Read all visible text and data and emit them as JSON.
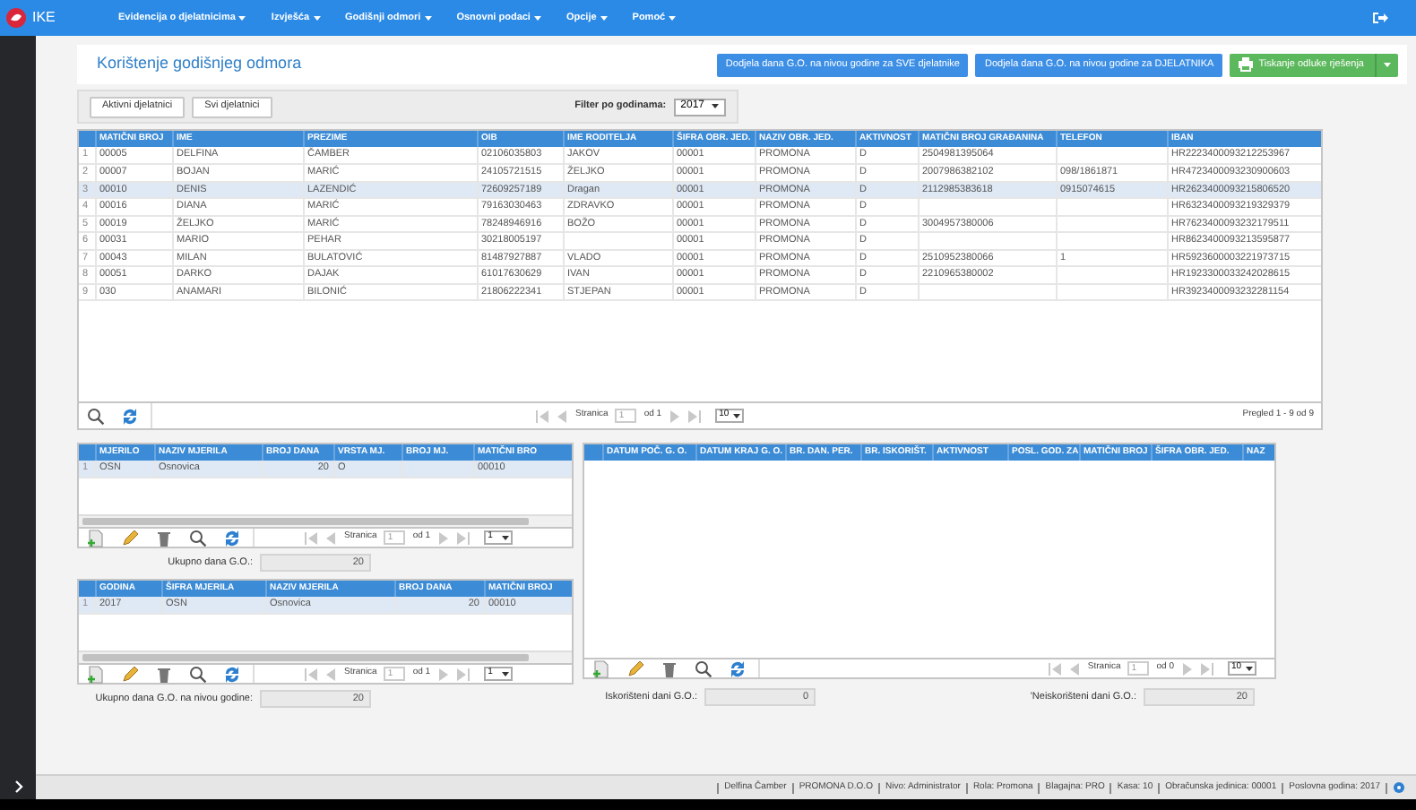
{
  "nav": {
    "brand": "IKE",
    "menus": [
      "Evidencija o djelatnicima",
      "Izvješća",
      "Godišnji odmori",
      "Osnovni podaci",
      "Opcije",
      "Pomoć"
    ]
  },
  "header": {
    "title": "Korištenje godišnjeg odmora",
    "buttons": [
      {
        "label": "Dodjela dana G.O. na nivou godine za SVE djelatnike",
        "kind": "primary"
      },
      {
        "label": "Dodjela dana G.O. na nivou godine za DJELATNIKA",
        "kind": "primary"
      },
      {
        "label": "Tiskanje odluke rješenja",
        "kind": "print"
      }
    ]
  },
  "filter": {
    "buttons": [
      "Aktivni djelatnici",
      "Svi djelatnici"
    ],
    "label": "Filter po godinama:",
    "year": "2017"
  },
  "employees": {
    "columns": [
      "MATIČNI BROJ",
      "IME",
      "PREZIME",
      "OIB",
      "IME RODITELJA",
      "ŠIFRA OBR. JED.",
      "NAZIV OBR. JED.",
      "AKTIVNOST",
      "MATIČNI BROJ GRAĐANINA",
      "TELEFON",
      "IBAN"
    ],
    "rows": [
      {
        "num": "1",
        "selected": false,
        "cells": [
          "00005",
          "DELFINA",
          "ČAMBER",
          "02106035803",
          "JAKOV",
          "00001",
          "PROMONA",
          "D",
          "2504981395064",
          "",
          "HR2223400093212253967"
        ]
      },
      {
        "num": "2",
        "selected": false,
        "cells": [
          "00007",
          "BOJAN",
          "MARIĆ",
          "24105721515",
          "ŽELJKO",
          "00001",
          "PROMONA",
          "D",
          "2007986382102",
          "098/1861871",
          "HR4723400093230900603"
        ]
      },
      {
        "num": "3",
        "selected": true,
        "cells": [
          "00010",
          "DENIS",
          "LAZENDIĆ",
          "72609257189",
          "Dragan",
          "00001",
          "PROMONA",
          "D",
          "2112985383618",
          "0915074615",
          "HR2623400093215806520"
        ]
      },
      {
        "num": "4",
        "selected": false,
        "cells": [
          "00016",
          "DIANA",
          "MARIĆ",
          "79163030463",
          "ZDRAVKO",
          "00001",
          "PROMONA",
          "D",
          "",
          "",
          "HR6323400093219329379"
        ]
      },
      {
        "num": "5",
        "selected": false,
        "cells": [
          "00019",
          "ŽELJKO",
          "MARIĆ",
          "78248946916",
          "BOŽO",
          "00001",
          "PROMONA",
          "D",
          "3004957380006",
          "",
          "HR7623400093232179511"
        ]
      },
      {
        "num": "6",
        "selected": false,
        "cells": [
          "00031",
          "MARIO",
          "PEHAR",
          "30218005197",
          "",
          "00001",
          "PROMONA",
          "D",
          "",
          "",
          "HR8623400093213595877"
        ]
      },
      {
        "num": "7",
        "selected": false,
        "cells": [
          "00043",
          "MILAN",
          "BULATOVIĆ",
          "81487927887",
          "VLADO",
          "00001",
          "PROMONA",
          "D",
          "2510952380066",
          "1",
          "HR5923600003221973715"
        ]
      },
      {
        "num": "8",
        "selected": false,
        "cells": [
          "00051",
          "DARKO",
          "DAJAK",
          "61017630629",
          "IVAN",
          "00001",
          "PROMONA",
          "D",
          "2210965380002",
          "",
          "HR1923300033242028615"
        ]
      },
      {
        "num": "9",
        "selected": false,
        "cells": [
          "030",
          "ANAMARI",
          "BILONIĆ",
          "21806222341",
          "STJEPAN",
          "00001",
          "PROMONA",
          "D",
          "",
          "",
          "HR3923400093232281154"
        ]
      }
    ],
    "pager": {
      "label": "Stranica",
      "page": "1",
      "of": "od 1",
      "size": "10"
    },
    "summary": "Pregled 1 - 9 od 9"
  },
  "measures": {
    "columns": [
      "MJERILO",
      "NAZIV MJERILA",
      "BROJ DANA",
      "VRSTA MJ.",
      "BROJ MJ.",
      "MATIČNI BRO"
    ],
    "rows": [
      {
        "num": "1",
        "selected": true,
        "cells": [
          "OSN",
          "Osnovica",
          "20",
          "O",
          "",
          "00010"
        ]
      }
    ],
    "pager": {
      "label": "Stranica",
      "page": "1",
      "of": "od 1",
      "size": "1"
    },
    "total": {
      "label": "Ukupno dana G.O.:",
      "value": "20"
    }
  },
  "yearly": {
    "columns": [
      "GODINA",
      "ŠIFRA MJERILA",
      "NAZIV MJERILA",
      "BROJ DANA",
      "MATIČNI BROJ"
    ],
    "rows": [
      {
        "num": "1",
        "selected": true,
        "cells": [
          "2017",
          "OSN",
          "Osnovica",
          "20",
          "00010"
        ]
      }
    ],
    "pager": {
      "label": "Stranica",
      "page": "1",
      "of": "od 1",
      "size": "1"
    },
    "total": {
      "label": "Ukupno dana G.O. na nivou godine:",
      "value": "20"
    }
  },
  "leave": {
    "columns": [
      "DATUM POČ. G. O.",
      "DATUM KRAJ G. O.",
      "BR. DAN. PER.",
      "BR. ISKORIŠT.",
      "AKTIVNOST",
      "POSL. GOD. ZA",
      "MATIČNI BROJ",
      "ŠIFRA OBR. JED.",
      "NAZ"
    ],
    "pager": {
      "label": "Stranica",
      "page": "1",
      "of": "od 0",
      "size": "10"
    },
    "used": {
      "label": "Iskorišteni dani G.O.:",
      "value": "0"
    },
    "unused": {
      "label": "'Neiskorišteni dani G.O.:",
      "value": "20"
    }
  },
  "status_bar": [
    "Delfina Čamber",
    "PROMONA D.O.O",
    "Nivo: Administrator",
    "Rola: Promona",
    "Blagajna: PRO",
    "Kasa: 10",
    "Obračunska jedinica: 00001",
    "Poslovna godina: 2017"
  ]
}
